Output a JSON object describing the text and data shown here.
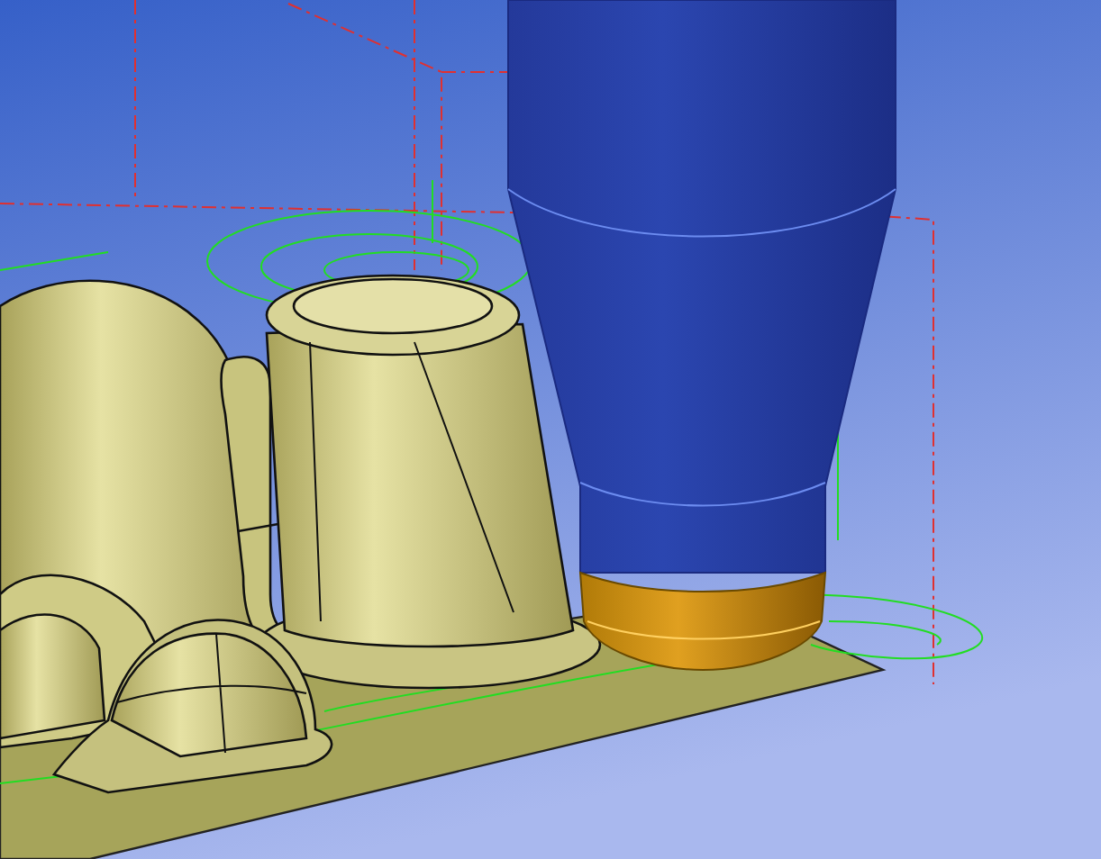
{
  "scene": {
    "kind": "render"
  }
}
